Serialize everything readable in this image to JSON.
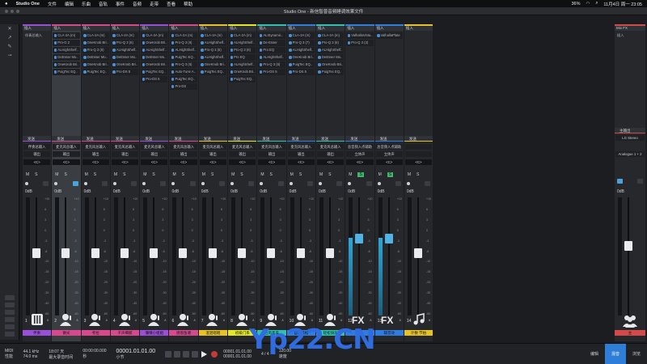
{
  "menubar": {
    "apple": "",
    "app": "Studio One",
    "items": [
      "文件",
      "编辑",
      "乐曲",
      "音轨",
      "事件",
      "音频",
      "走带",
      "查看",
      "帮助"
    ],
    "battery": "36%",
    "datetime": "11月4日 周一 23:05"
  },
  "window": {
    "title": "Studio One - 新信智普音频睡调效果文件"
  },
  "lefttools": [
    "✕",
    "↗",
    "✎",
    "⊸"
  ],
  "channels": [
    {
      "num": "1",
      "name": "伴奏",
      "color": "#9b4fd8",
      "insert_head": "插入",
      "plugins": [
        "伴奏总输入"
      ],
      "plugins_plain": true,
      "input": "伴奏总输入",
      "output": "输出",
      "pan": "<C>",
      "vol": "0dB",
      "mono": "",
      "icon": "mixer",
      "meter": false,
      "fader_pos": 0.47
    },
    {
      "num": "2",
      "name": "散光",
      "color": "#d44a8c",
      "insert_head": "插入",
      "plugins": [
        "CLA-2A (m)",
        "Pro-G 2",
        "ALHighShelf..",
        "DeEsser Mo..",
        "OneKnob Bri..",
        "PuigTec EQ.."
      ],
      "input": "麦克风总输入",
      "output": "输出",
      "pan": "<C>",
      "vol": "0dB",
      "mono": "",
      "icon": "singer",
      "meter": false,
      "fader_pos": 0.47,
      "selected": true
    },
    {
      "num": "3",
      "name": "考拉",
      "color": "#d44a8c",
      "insert_head": "插入",
      "plugins": [
        "CLA-2A (m)",
        "OneKnob Bri..",
        "Pro-Q 3 (6)",
        "DeEsser Mo..",
        "OneKnob Bri..",
        "PuigTec EQ.."
      ],
      "input": "麦克风总输入",
      "output": "输出",
      "pan": "<C>",
      "vol": "0dB",
      "mono": "",
      "icon": "singer",
      "meter": false,
      "fader_pos": 0.47
    },
    {
      "num": "4",
      "name": "千声细腻",
      "color": "#d44a8c",
      "insert_head": "插入",
      "plugins": [
        "CLA-2A (m)",
        "Pro-Q 3 (6)",
        "ALHighShelf..",
        "DeEsser Mo..",
        "OneKnob Bri..",
        "Pro-DS 5"
      ],
      "input": "麦克风总输入",
      "output": "输出",
      "pan": "<C>",
      "vol": "0dB",
      "mono": "",
      "icon": "singer",
      "meter": false,
      "fader_pos": 0.47
    },
    {
      "num": "5",
      "name": "慵懒小姐姐",
      "color": "#9b4fd8",
      "insert_head": "插入",
      "plugins": [
        "CLA-2A (m)",
        "OneKnob Bri..",
        "ALHighShelf..",
        "DeEsser Mo..",
        "OneKnob Bri..",
        "PuigTec EQ..",
        "Pro-DS 5"
      ],
      "input": "麦克风总输入",
      "output": "输出",
      "pan": "<C>",
      "vol": "0dB",
      "mono": "",
      "icon": "singer",
      "meter": false,
      "fader_pos": 0.47
    },
    {
      "num": "6",
      "name": "感恩鱼塘",
      "color": "#d44a8c",
      "insert_head": "插入",
      "plugins": [
        "CLA-2A (m)",
        "Pro-Q 3 (6)",
        "ALHighShelf..",
        "PuigTec EQ..",
        "Pro-Q 3 (6)",
        "Auto-Tune A..",
        "PuigTec EQ..",
        "Pro-DS"
      ],
      "input": "麦克风总输入",
      "output": "输出",
      "pan": "<C>",
      "vol": "0dB",
      "mono": "",
      "icon": "singer",
      "meter": false,
      "fader_pos": 0.47
    },
    {
      "num": "7",
      "name": "混混唱唱",
      "color": "#e6c229",
      "insert_head": "插入",
      "plugins": [
        "CLA-2A (m)",
        "ALHighShelf..",
        "Pro-Q 3 (6)",
        "ALHighShelf..",
        "OneKnob Bri..",
        "PuigTec EQ.."
      ],
      "input": "麦克风总输入",
      "output": "输出",
      "pan": "<C>",
      "vol": "0dB",
      "mono": "",
      "icon": "singer",
      "meter": false,
      "fader_pos": 0.47
    },
    {
      "num": "8",
      "name": "初级门系",
      "color": "#e6e629",
      "insert_head": "插入",
      "plugins": [
        "CLA-2A (m)",
        "ALHighShelf..",
        "Pro-Q 3 (6)",
        "Pro EQ",
        "ALHighShelf..",
        "OneKnob Bri..",
        "PuigTec EQ.."
      ],
      "input": "麦克风总输入",
      "output": "输出",
      "pan": "<C>",
      "vol": "0dB",
      "mono": "",
      "icon": "singer",
      "meter": false,
      "fader_pos": 0.47
    },
    {
      "num": "9",
      "name": "古风柔美",
      "color": "#2fc0b0",
      "insert_head": "插入",
      "plugins": [
        "ALISynamic..",
        "De-Esser",
        "Pro EQ",
        "ALHighShelf..",
        "Pro-Q 3 (6)",
        "Pro-DS 5"
      ],
      "input": "麦克风总输入",
      "output": "输出",
      "pan": "<C>",
      "vol": "0dB",
      "mono": "",
      "icon": "singer",
      "meter": false,
      "fader_pos": 0.47
    },
    {
      "num": "10",
      "name": "自然蓬松",
      "color": "#2f7de0",
      "insert_head": "插入",
      "plugins": [
        "CLA-2A (m)",
        "Pro-Q 3 (7)",
        "ALHighShelf..",
        "OneKnob Bri..",
        "PuigTec EQ..",
        "Pro-DS 5"
      ],
      "input": "麦克风总输入",
      "output": "输出",
      "pan": "<C>",
      "vol": "0dB",
      "mono": "",
      "icon": "singer",
      "meter": false,
      "fader_pos": 0.47
    },
    {
      "num": "11",
      "name": "轻松快乐",
      "color": "#2fc0b0",
      "insert_head": "插入",
      "plugins": [
        "CLA-2A (m)",
        "Pro-Q 3 (6)",
        "ALHighShelf..",
        "DeEsser Mo..",
        "OneKnob Bri..",
        "PuigTec EQ.."
      ],
      "input": "麦克风总输入",
      "output": "输出",
      "pan": "<C>",
      "vol": "0dB",
      "mono": "",
      "icon": "singer",
      "meter": false,
      "fader_pos": 0.47
    },
    {
      "num": "12",
      "name": "FX",
      "color": "#2f7de0",
      "insert_head": "插入",
      "plugins": [
        "ValhallaVinta..",
        "Pro-Q 3 (3)"
      ],
      "input": "总音频入点辅助",
      "output": "立体声",
      "pan": "<C>",
      "vol": "0dB",
      "mono": "on",
      "icon": "fx",
      "meter": true,
      "fader_pos": 0.35
    },
    {
      "num": "13",
      "name": "辅音效",
      "color": "#2f7de0",
      "insert_head": "插入",
      "plugins": [
        "ValhallaPlate"
      ],
      "input": "总音频入点辅助",
      "output": "立体声",
      "pan": "<C>",
      "vol": "0dB",
      "mono": "on",
      "icon": "fx",
      "meter": true,
      "fader_pos": 0.35
    },
    {
      "num": "14",
      "name": "计数 节拍",
      "color": "#e6c229",
      "insert_head": "插入",
      "plugins": [],
      "input": "",
      "output": "",
      "pan": "<C>",
      "vol": "0dB",
      "mono": "",
      "icon": "notes",
      "meter": false,
      "fader_pos": 0.47
    }
  ],
  "sends_label": "发送",
  "ms": {
    "m": "M",
    "s": "S"
  },
  "fader_scale": [
    "+10",
    "6",
    "3",
    "0",
    "-3",
    "-6",
    "-10",
    "-15",
    "-20",
    "-30",
    "-40",
    "-60"
  ],
  "main": {
    "title": "Mix FX",
    "insert_head": "插入",
    "out_title": "主输出",
    "out_device": "LG Stereo",
    "out_input": "Analogue 1 + 2",
    "name": "主",
    "color": "#d44a4a"
  },
  "transport": {
    "midi": "MIDI",
    "perf": "性能",
    "rate": "44.1 kHz",
    "latency": "74.0 ms",
    "record_time": "18:07 天",
    "record_label": "最大录音时间",
    "time": "00:00:00.000",
    "time_label": "秒",
    "bars": "00001.01.01.00",
    "bars_label": "小节",
    "loop_start": "00001.01.01.00",
    "loop_end": "00001.01.01.00",
    "signature": "4 / 4",
    "tempo": "120.00",
    "tempo_label": "速度",
    "tabs": [
      "编辑",
      "混音",
      "浏览"
    ],
    "active_tab": "混音"
  },
  "watermark": "Yp22.CN"
}
